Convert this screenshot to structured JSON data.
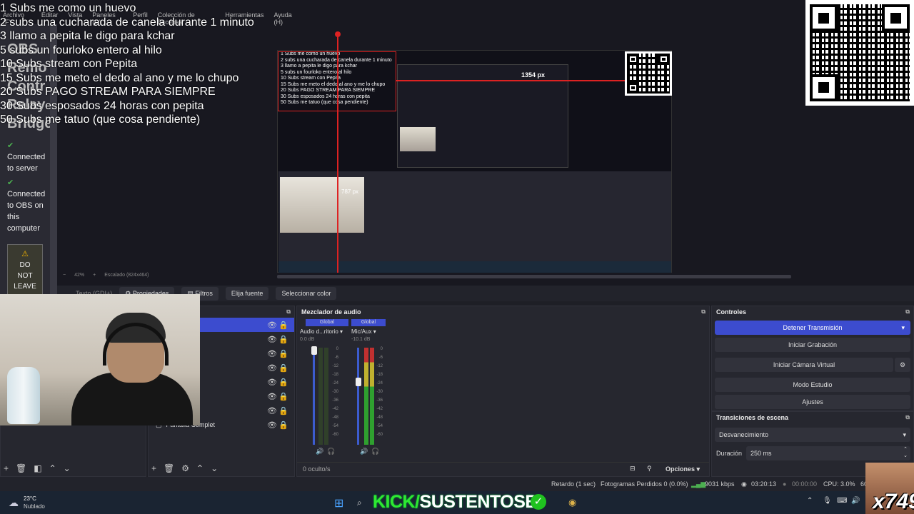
{
  "menu": [
    "Archivo (F)",
    "Editar",
    "Vista",
    "Paneles (D)",
    "Perfil",
    "Colección de Escenas",
    "Herramientas",
    "Ayuda (H)"
  ],
  "subs_list": [
    "1 Subs me como un huevo",
    "2 subs una cucharada de canela durante 1 minuto",
    "3 llamo a pepita  le digo para kchar",
    "5 subs un fourloko entero al hilo",
    "10 Subs  stream con Pepita",
    "15 Subs me meto el dedo al ano y me lo chupo",
    "20 Subs PAGO STREAM  PARA SIEMPRE",
    "30 Subs esposados 24 horas con pepita",
    "50 Subs me tatuo (que cosa pendiente)"
  ],
  "sidebar": {
    "title_lines": [
      "OBS",
      "Remo",
      "Contr",
      "Relay",
      "Bridge"
    ],
    "status_server": "Connected to server",
    "status_obs": "Connected to OBS on this computer",
    "warning": "DO NOT LEAVE"
  },
  "preview": {
    "size_label_1": "1354 px",
    "size_label_2": "787 px",
    "zoom": "42%",
    "scaled": "Escalado (824x464)"
  },
  "toolbar": {
    "source_name": "Texto (GDI+)",
    "properties": "Propiedades",
    "filters": "Filtros",
    "choose_source": "Elija fuente",
    "select_color": "Seleccionar color"
  },
  "sources": {
    "last_item": "Pantalla Complet"
  },
  "mixer": {
    "title": "Mezclador de audio",
    "channels": [
      {
        "tag": "Global",
        "name": "Audio d...ritorio",
        "db": "0.0 dB",
        "level": 0.0
      },
      {
        "tag": "Global",
        "name": "Mic/Aux",
        "db": "-10.1 dB",
        "level": 0.55
      }
    ],
    "scale": [
      "0",
      "-6",
      "-12",
      "-18",
      "-24",
      "-30",
      "-36",
      "-42",
      "-48",
      "-54",
      "-60"
    ],
    "hidden": "0 oculto/s",
    "options": "Opciones"
  },
  "controls": {
    "title": "Controles",
    "stop_stream": "Detener Transmisión",
    "start_recording": "Iniciar Grabación",
    "start_vcam": "Iniciar Cámara Virtual",
    "studio_mode": "Modo Estudio",
    "settings": "Ajustes"
  },
  "transitions": {
    "title": "Transiciones de escena",
    "selected": "Desvanecimiento",
    "duration_label": "Duración",
    "duration_value": "250 ms"
  },
  "status": {
    "delay": "Retardo (1 sec)",
    "dropped": "Fotogramas Perdidos 0 (0.0%)",
    "bitrate": "9031 kbps",
    "live_time": "03:20:13",
    "rec_time": "00:00:00",
    "cpu": "CPU: 3.0%",
    "fps_partial": "60"
  },
  "taskbar": {
    "temp": "23°C",
    "weather": "Nublado"
  },
  "kick": {
    "prefix": "KICK/",
    "channel": "SUSTENTOSB"
  },
  "overlay_tag": "x749",
  "colors": {
    "accent": "#3c4ccf",
    "kick_green": "#2ee832",
    "selection_red": "#dd2222"
  }
}
